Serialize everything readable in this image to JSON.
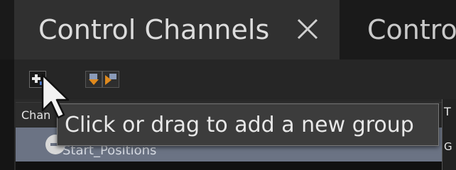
{
  "tabs": [
    {
      "label": "Control Channels",
      "active": true,
      "closable": true
    },
    {
      "label": "Contro",
      "active": false
    }
  ],
  "toolbar": {
    "buttons": [
      {
        "icon": "add-group-icon"
      },
      {
        "icon": "import-icon"
      },
      {
        "icon": "export-icon"
      }
    ]
  },
  "table": {
    "column_header": "Chan",
    "right_column_fragments": [
      "T",
      "G"
    ]
  },
  "groups": [
    {
      "label": "Start_Positions",
      "expanded": true
    }
  ],
  "tooltip": {
    "text": "Click or drag to add a new group"
  },
  "colors": {
    "accent_orange": "#e08a1e",
    "group_row": "#6b7384",
    "tab_active": "#303030"
  }
}
